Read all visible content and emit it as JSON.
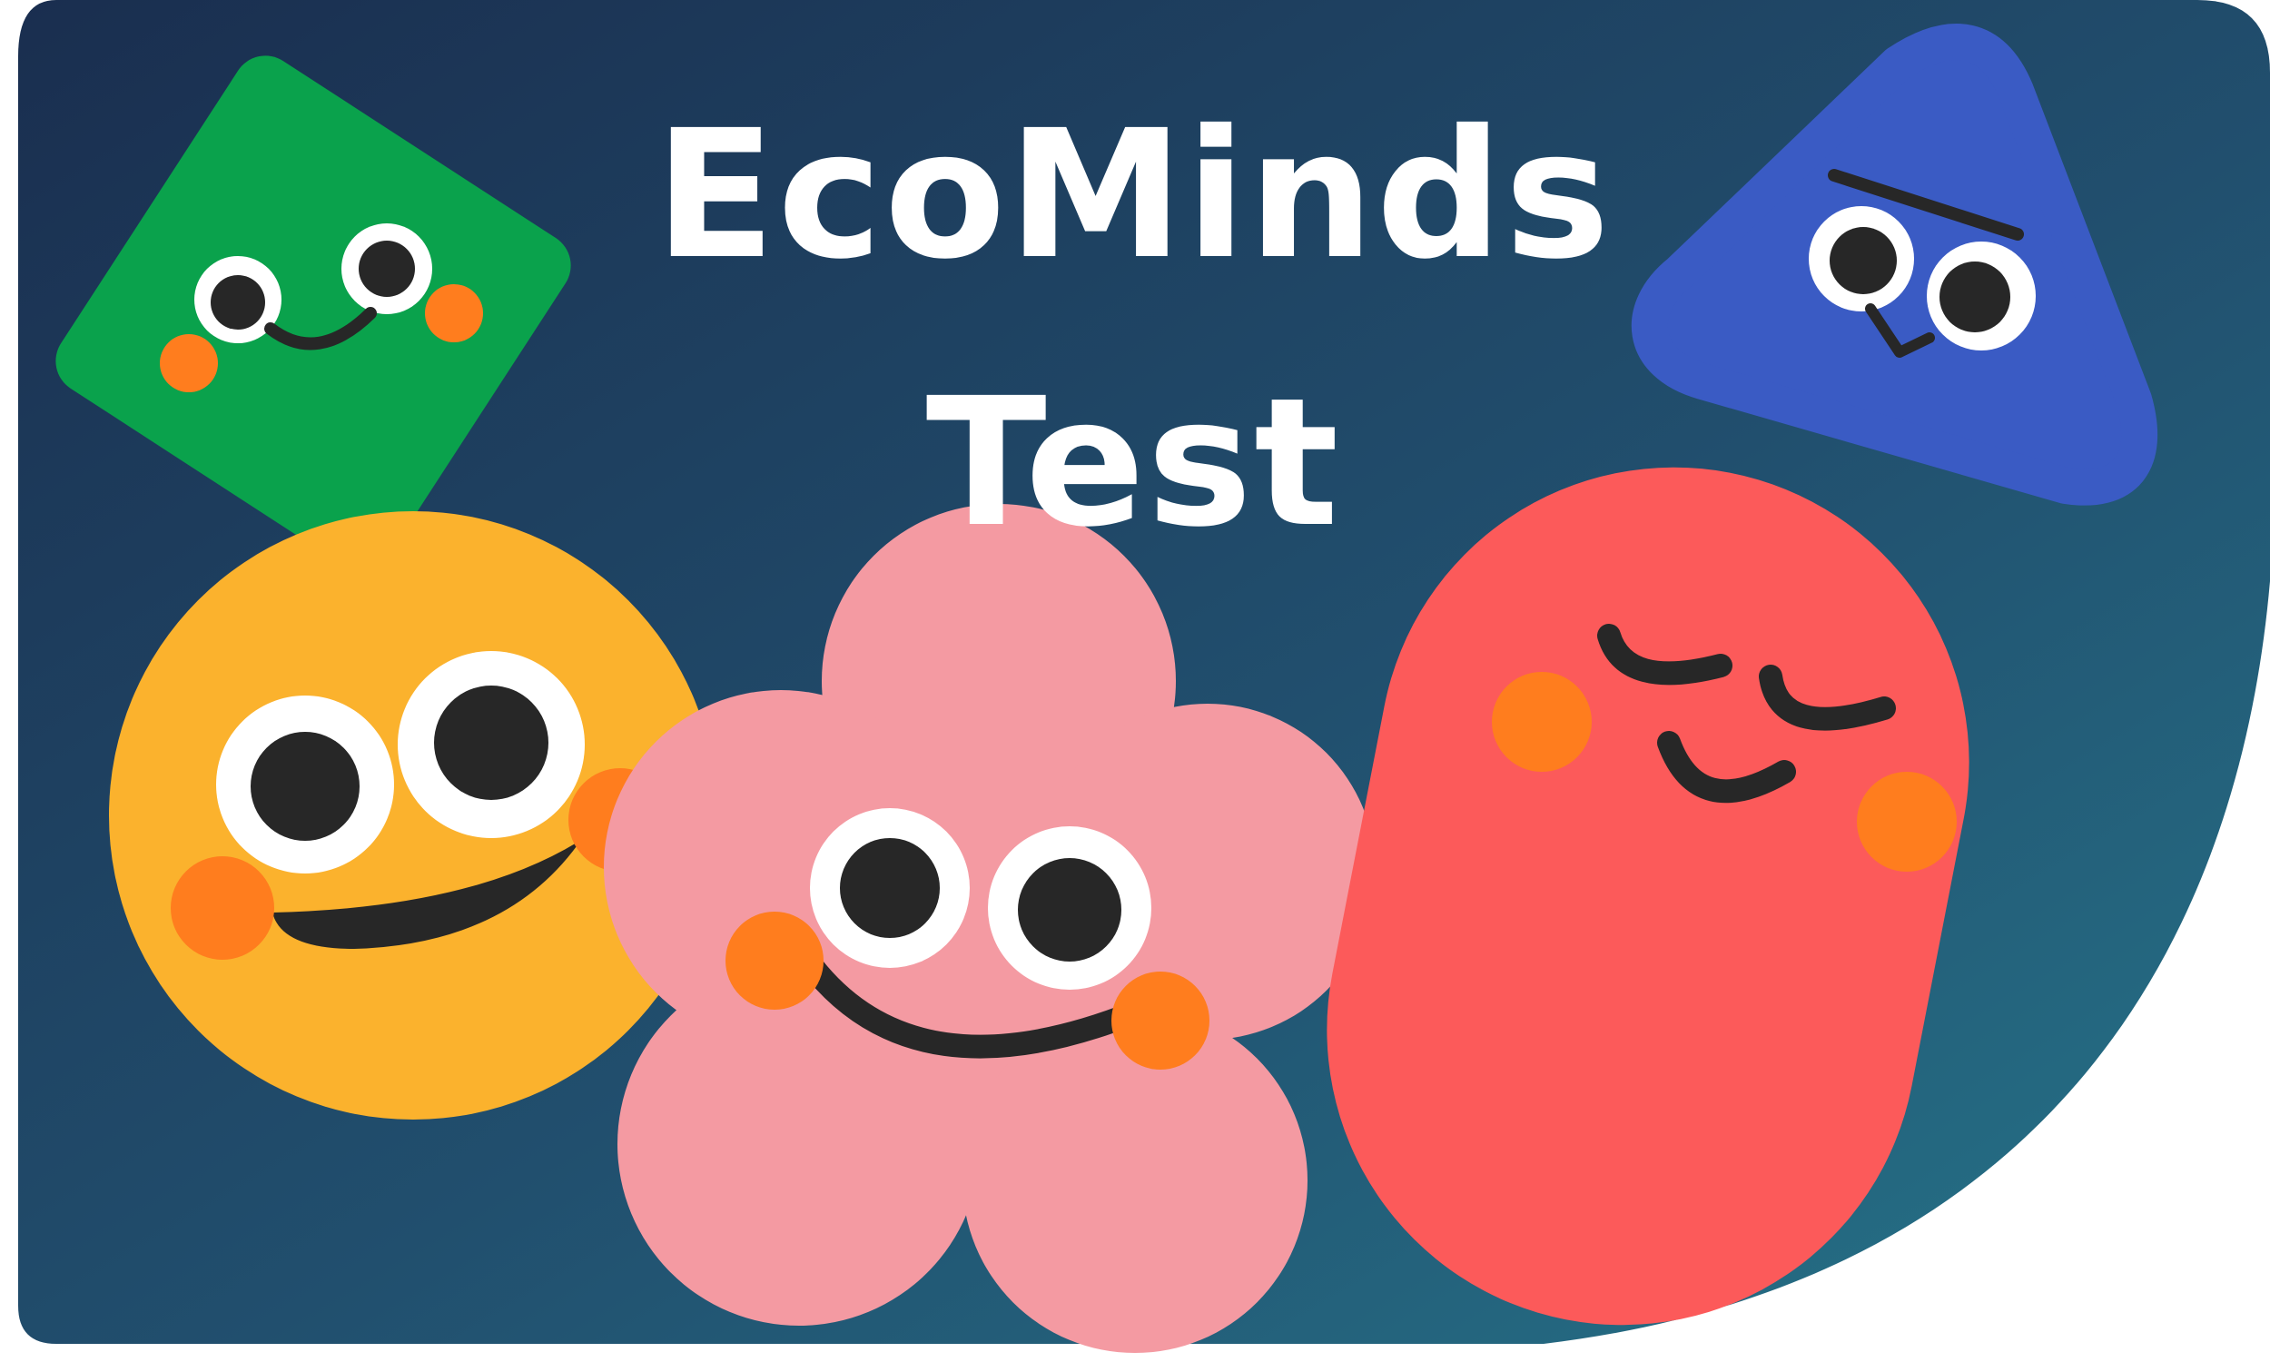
{
  "title": {
    "line1": "EcoMinds",
    "line2": "Test"
  },
  "characters": [
    {
      "name": "green-square-character",
      "shape": "rounded-square",
      "color": "#0aa24c"
    },
    {
      "name": "blue-triangle-character",
      "shape": "rounded-triangle",
      "color": "#3a5bc4"
    },
    {
      "name": "yellow-circle-character",
      "shape": "circle",
      "color": "#fbb22d"
    },
    {
      "name": "pink-flower-character",
      "shape": "flower",
      "color": "#f49aa2"
    },
    {
      "name": "red-pill-character",
      "shape": "pill",
      "color": "#fc5a5a"
    }
  ],
  "colors": {
    "background_top": "#1b3252",
    "background_bottom": "#256f86",
    "title": "#ffffff",
    "cheek": "#ff7d1e",
    "eye_white": "#ffffff",
    "eye_dark": "#272727"
  }
}
